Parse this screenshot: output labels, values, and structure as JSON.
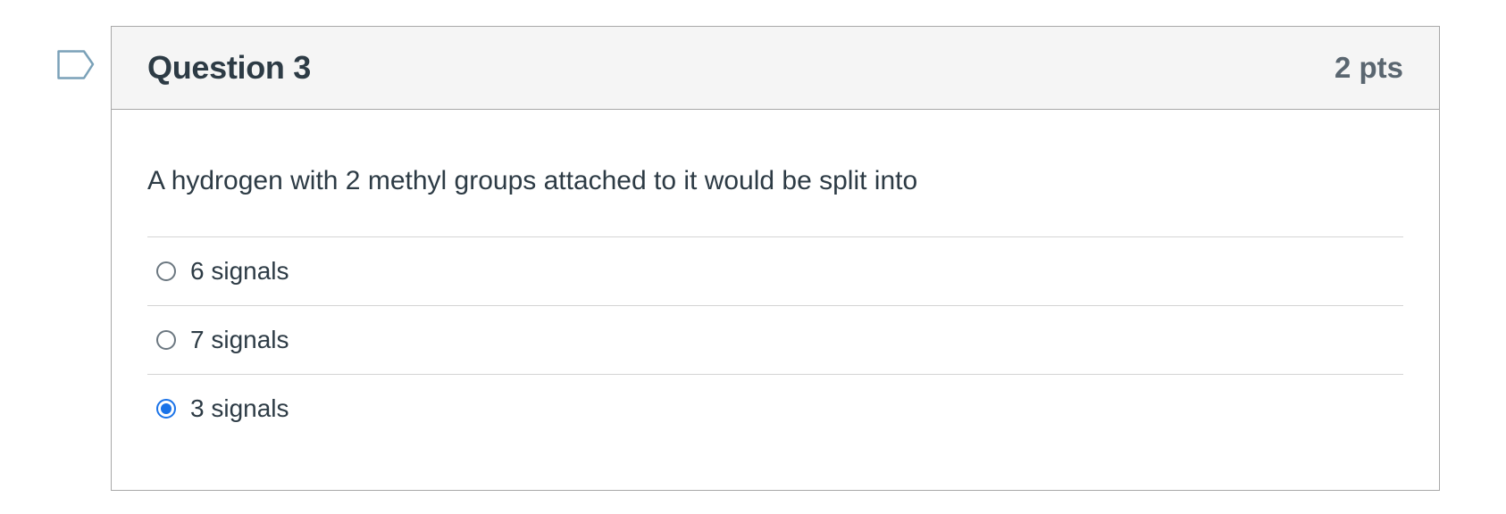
{
  "flag": {
    "icon": "bookmark-flag-icon"
  },
  "question": {
    "title": "Question 3",
    "points": "2 pts",
    "text": "A hydrogen with 2 methyl groups attached to it would be split into"
  },
  "answers": [
    {
      "label": "6 signals",
      "selected": false
    },
    {
      "label": "7 signals",
      "selected": false
    },
    {
      "label": "3 signals",
      "selected": true
    }
  ],
  "colors": {
    "accent": "#1a73e8",
    "text": "#2d3b45",
    "muted": "#5a6670",
    "header_bg": "#f5f5f5",
    "border": "#a8a8a8",
    "divider": "#d4d4d4"
  }
}
